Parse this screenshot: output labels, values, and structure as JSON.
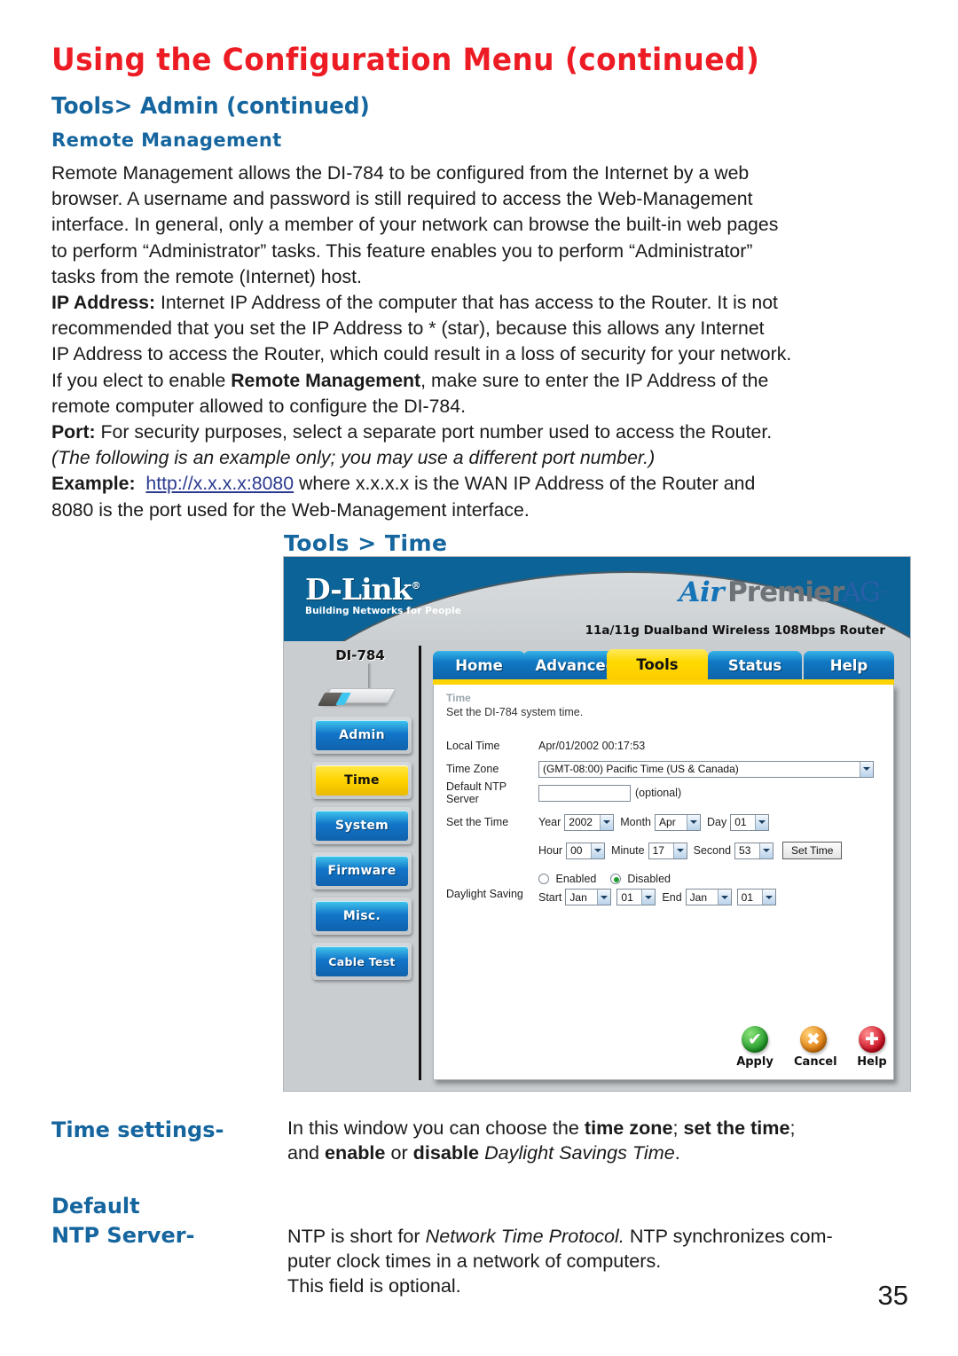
{
  "page": {
    "title": "Using the Configuration Menu (continued)",
    "section_heading": "Tools> Admin (continued)",
    "sub_heading": "Remote Management",
    "folio": "35",
    "accent_red": "#ed1c24",
    "accent_blue": "#15659e",
    "link_color": "#2b3a8f"
  },
  "body": {
    "para1_line1": "Remote Management allows the DI-784 to be configured from the Internet by a web",
    "para1_line2": "browser. A username and password is still required to access the Web-Management",
    "para1_line3": "interface. In general, only a member of your network can browse the built-in web pages",
    "para1_line4": "to perform “Administrator” tasks. This feature enables you to perform “Administrator”",
    "para1_line5": "tasks from the remote (Internet) host.",
    "ip_label": "IP Address:",
    "ip_line1": " Internet IP Address of the computer that has access to the Router. It is not",
    "ip_line2": "recommended that you set the IP Address to * (star), because this allows any Internet",
    "ip_line3": "IP Address to access the Router, which could result in a loss of security for your network.",
    "ip_line4_a": "If you elect to enable ",
    "ip_line4_bold": "Remote Management",
    "ip_line4_b": ", make sure to enter the IP Address of the",
    "ip_line5": "remote computer allowed to configure the DI-784.",
    "port_label": "Port:",
    "port_text": " For security purposes, select a separate port number used to access the Router.",
    "port_italic": "(The following is an example only; you may use a different port number.)",
    "example_label": "Example:",
    "example_link": "http://x.x.x.x:8080",
    "example_rest": " where x.x.x.x is the WAN IP Address of the  Router and",
    "example_line2": "8080 is the port used for the Web-Management interface."
  },
  "figure": {
    "caption": "Tools > Time",
    "banner": {
      "brand_main": "D-Link",
      "brand_registered": "®",
      "brand_tagline": "Building Networks for People",
      "product_air": "Air",
      "product_premier": "Premier",
      "product_ag": "AG",
      "product_tm": "™",
      "model_line": "11a/11g Dualband Wireless 108Mbps Router"
    },
    "sidebar": {
      "device_name": "DI-784",
      "items": [
        {
          "label": "Admin",
          "active": false
        },
        {
          "label": "Time",
          "active": true
        },
        {
          "label": "System",
          "active": false
        },
        {
          "label": "Firmware",
          "active": false
        },
        {
          "label": "Misc.",
          "active": false
        },
        {
          "label": "Cable Test",
          "active": false
        }
      ]
    },
    "tabs": [
      {
        "label": "Home",
        "active": false
      },
      {
        "label": "Advanced",
        "active": false
      },
      {
        "label": "Tools",
        "active": true
      },
      {
        "label": "Status",
        "active": false
      },
      {
        "label": "Help",
        "active": false
      }
    ],
    "panel": {
      "heading": "Time",
      "description": "Set the DI-784 system time.",
      "rows": {
        "local_time_label": "Local Time",
        "local_time_value": "Apr/01/2002 00:17:53",
        "time_zone_label": "Time Zone",
        "time_zone_value": "(GMT-08:00) Pacific Time (US & Canada)",
        "ntp_label": "Default NTP Server",
        "ntp_value": "",
        "ntp_optional": "(optional)",
        "set_time_label": "Set the Time",
        "year_label": "Year",
        "year_value": "2002",
        "month_label": "Month",
        "month_value": "Apr",
        "day_label": "Day",
        "day_value": "01",
        "hour_label": "Hour",
        "hour_value": "00",
        "minute_label": "Minute",
        "minute_value": "17",
        "second_label": "Second",
        "second_value": "53",
        "set_time_button": "Set Time",
        "dst_label": "Daylight Saving",
        "dst_enabled_label": "Enabled",
        "dst_disabled_label": "Disabled",
        "dst_selected": "Disabled",
        "dst_start_label": "Start",
        "dst_start_month": "Jan",
        "dst_start_day": "01",
        "dst_end_label": "End",
        "dst_end_month": "Jan",
        "dst_end_day": "01"
      }
    },
    "actions": [
      {
        "label": "Apply",
        "glyph": "✔",
        "color": "#1f9b28"
      },
      {
        "label": "Cancel",
        "glyph": "✖",
        "color": "#e07b0a"
      },
      {
        "label": "Help",
        "glyph": "✚",
        "color": "#cc0a1e"
      }
    ]
  },
  "captions": [
    {
      "term_line1": "Time settings-",
      "term_line2": "",
      "def_a": "In this window you can choose the ",
      "def_b_bold": "time zone",
      "def_c": "; ",
      "def_d_bold": "set the time",
      "def_e": ";",
      "def2_a": "and ",
      "def2_b_bold": "enable",
      "def2_c": " or ",
      "def2_d_bold": "disable",
      "def2_e": " ",
      "def2_f_italic": "Daylight Savings Time",
      "def2_g": "."
    },
    {
      "term_line1": "Default",
      "term_line2": "NTP Server-",
      "def_a": "NTP is short for ",
      "def_b_italic": "Network Time Protocol.",
      "def_c": " NTP synchronizes com-",
      "def2": "puter clock times in a network of computers.",
      "def3": "This field is optional."
    }
  ]
}
